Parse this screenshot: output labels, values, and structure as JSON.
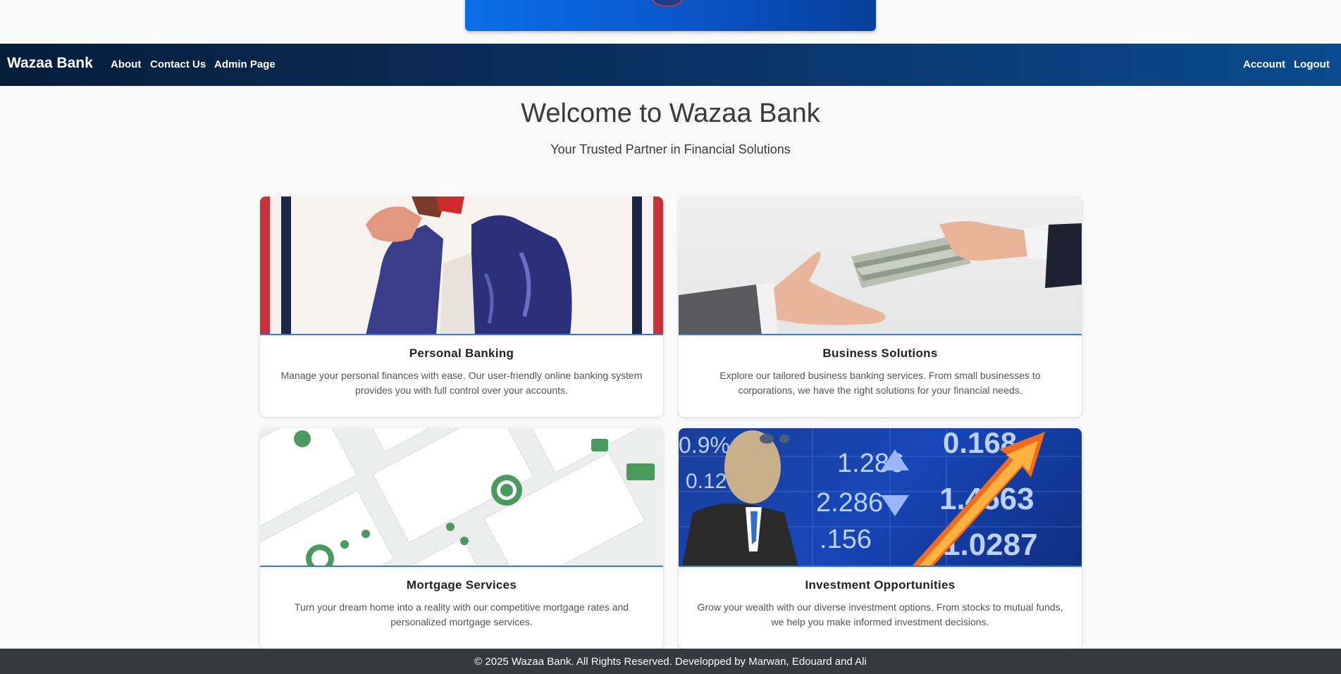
{
  "brand": "Wazaa Bank",
  "nav": {
    "left_links": [
      "About",
      "Contact Us",
      "Admin Page"
    ],
    "right_links": [
      "Account",
      "Logout"
    ]
  },
  "hero": {
    "title": "Welcome to Wazaa Bank",
    "subtitle": "Your Trusted Partner in Financial Solutions"
  },
  "cards": [
    {
      "title": "Personal Banking",
      "text": "Manage your personal finances with ease. Our user-friendly online banking system provides you with full control over your accounts."
    },
    {
      "title": "Business Solutions",
      "text": "Explore our tailored business banking services. From small businesses to corporations, we have the right solutions for your financial needs."
    },
    {
      "title": "Mortgage Services",
      "text": "Turn your dream home into a reality with our competitive mortgage rates and personalized mortgage services."
    },
    {
      "title": "Investment Opportunities",
      "text": "Grow your wealth with our diverse investment options. From stocks to mutual funds, we help you make informed investment decisions."
    }
  ],
  "investment_image_text": {
    "values": [
      "0.9%",
      "0.12%",
      ".156",
      "1.286",
      "2.286",
      "1.4563",
      "1.0287",
      "0.168"
    ]
  },
  "footer": "© 2025 Wazaa Bank. All Rights Reserved. Developped by Marwan, Edouard and Ali",
  "colors": {
    "nav_dark": "#061d3a",
    "nav_light": "#0a4a8e",
    "accent": "#2f7de1",
    "footer": "#343a40"
  }
}
